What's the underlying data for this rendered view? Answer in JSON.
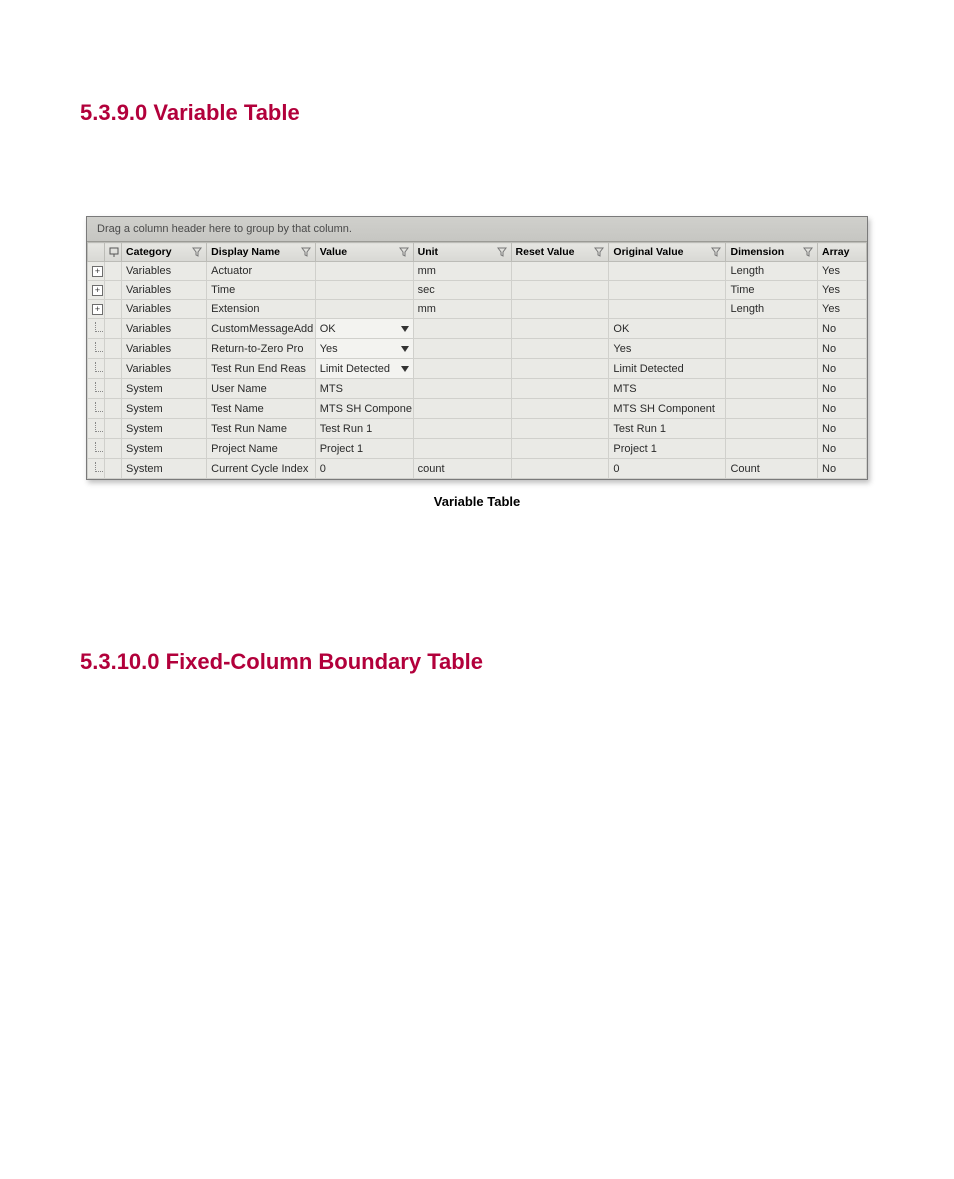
{
  "headings": {
    "section1": "5.3.9.0 Variable Table",
    "section2": "5.3.10.0 Fixed-Column Boundary Table"
  },
  "group_bar": "Drag a column header here to group by that column.",
  "columns": {
    "category": "Category",
    "display_name": "Display Name",
    "value": "Value",
    "unit": "Unit",
    "reset_value": "Reset Value",
    "original_value": "Original Value",
    "dimension": "Dimension",
    "array": "Array"
  },
  "rows": [
    {
      "expander": "plus",
      "category": "Variables",
      "display_name": "Actuator",
      "value": "",
      "value_dropdown": false,
      "unit": "mm",
      "reset_value": "",
      "original_value": "",
      "dimension": "Length",
      "array": "Yes"
    },
    {
      "expander": "plus",
      "category": "Variables",
      "display_name": "Time",
      "value": "",
      "value_dropdown": false,
      "unit": "sec",
      "reset_value": "",
      "original_value": "",
      "dimension": "Time",
      "array": "Yes"
    },
    {
      "expander": "plus",
      "category": "Variables",
      "display_name": "Extension",
      "value": "",
      "value_dropdown": false,
      "unit": "mm",
      "reset_value": "",
      "original_value": "",
      "dimension": "Length",
      "array": "Yes"
    },
    {
      "expander": "leaf",
      "category": "Variables",
      "display_name": "CustomMessageAdd",
      "value": "OK",
      "value_dropdown": true,
      "unit": "",
      "reset_value": "",
      "original_value": "OK",
      "dimension": "",
      "array": "No"
    },
    {
      "expander": "leaf",
      "category": "Variables",
      "display_name": "Return-to-Zero Pro",
      "value": "Yes",
      "value_dropdown": true,
      "unit": "",
      "reset_value": "",
      "original_value": "Yes",
      "dimension": "",
      "array": "No"
    },
    {
      "expander": "leaf",
      "category": "Variables",
      "display_name": "Test Run End Reas",
      "value": "Limit Detected",
      "value_dropdown": true,
      "unit": "",
      "reset_value": "",
      "original_value": "Limit Detected",
      "dimension": "",
      "array": "No"
    },
    {
      "expander": "leaf",
      "category": "System",
      "display_name": "User Name",
      "value": "MTS",
      "value_dropdown": false,
      "unit": "",
      "reset_value": "",
      "original_value": "MTS",
      "dimension": "",
      "array": "No"
    },
    {
      "expander": "leaf",
      "category": "System",
      "display_name": "Test Name",
      "value": "MTS SH Compone",
      "value_dropdown": false,
      "unit": "",
      "reset_value": "",
      "original_value": "MTS SH Component",
      "dimension": "",
      "array": "No"
    },
    {
      "expander": "leaf",
      "category": "System",
      "display_name": "Test Run Name",
      "value": "Test Run 1",
      "value_dropdown": false,
      "unit": "",
      "reset_value": "",
      "original_value": "Test Run 1",
      "dimension": "",
      "array": "No"
    },
    {
      "expander": "leaf",
      "category": "System",
      "display_name": "Project Name",
      "value": "Project 1",
      "value_dropdown": false,
      "unit": "",
      "reset_value": "",
      "original_value": "Project 1",
      "dimension": "",
      "array": "No"
    },
    {
      "expander": "leaf",
      "category": "System",
      "display_name": "Current Cycle Index",
      "value": "0",
      "value_dropdown": false,
      "unit": "count",
      "reset_value": "",
      "original_value": "0",
      "dimension": "Count",
      "array": "No"
    }
  ],
  "caption": "Variable Table"
}
